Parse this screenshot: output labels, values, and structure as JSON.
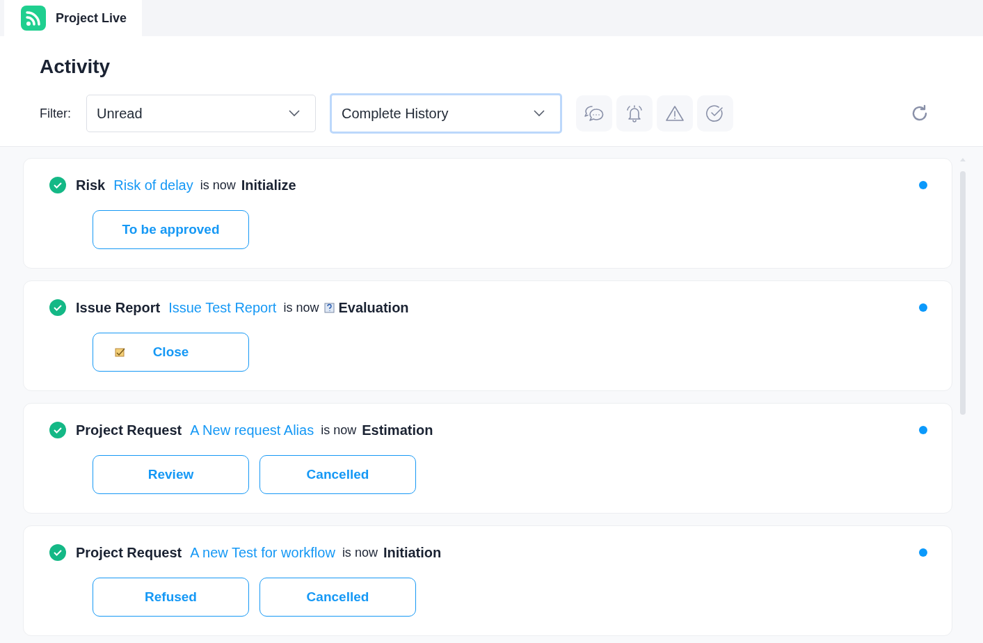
{
  "tab": {
    "title": "Project Live"
  },
  "header": {
    "title": "Activity",
    "filter_label": "Filter:"
  },
  "dropdowns": [
    {
      "value": "Unread",
      "focused": false
    },
    {
      "value": "Complete History",
      "focused": true
    }
  ],
  "filter_buttons": [
    {
      "kind": "chat"
    },
    {
      "kind": "bell"
    },
    {
      "kind": "warning"
    },
    {
      "kind": "check"
    }
  ],
  "activities": [
    {
      "type": "Risk",
      "link": "Risk of delay",
      "connector": "is now",
      "status": "Initialize",
      "status_icon": false,
      "unread": true,
      "done": true,
      "buttons": [
        {
          "label": "To be approved",
          "icon": false
        }
      ]
    },
    {
      "type": "Issue Report",
      "link": "Issue Test Report",
      "connector": "is now",
      "status": "Evaluation",
      "status_icon": true,
      "unread": true,
      "done": true,
      "buttons": [
        {
          "label": "Close",
          "icon": true
        }
      ]
    },
    {
      "type": "Project Request",
      "link": "A New request Alias",
      "connector": "is now",
      "status": "Estimation",
      "status_icon": false,
      "unread": true,
      "done": true,
      "buttons": [
        {
          "label": "Review",
          "icon": false
        },
        {
          "label": "Cancelled",
          "icon": false
        }
      ]
    },
    {
      "type": "Project Request",
      "link": "A new Test for workflow",
      "connector": "is now",
      "status": "Initiation",
      "status_icon": false,
      "unread": true,
      "done": true,
      "buttons": [
        {
          "label": "Refused",
          "icon": false
        },
        {
          "label": "Cancelled",
          "icon": false
        }
      ]
    }
  ]
}
